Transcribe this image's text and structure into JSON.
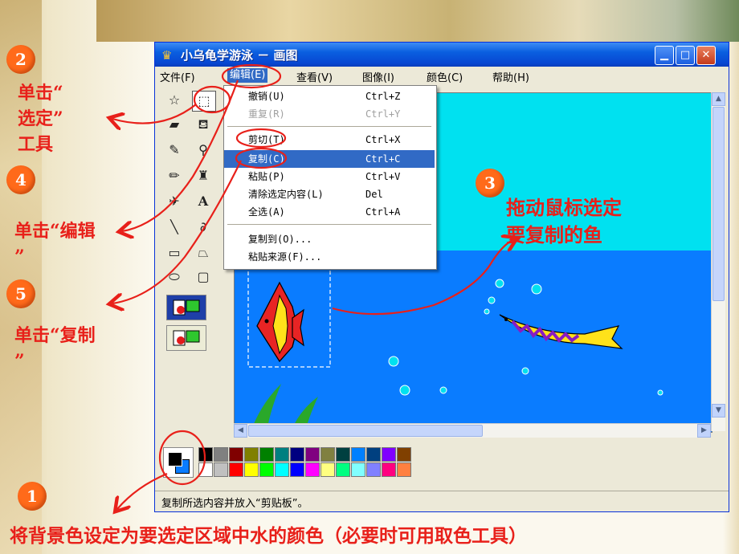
{
  "window": {
    "title": "小乌龟学游泳 － 画图",
    "controls": [
      "minimize",
      "maximize",
      "close"
    ]
  },
  "menubar": {
    "items": [
      "文件(F)",
      "编辑(E)",
      "查看(V)",
      "图像(I)",
      "颜色(C)",
      "帮助(H)"
    ],
    "active": "编辑(E)"
  },
  "edit_menu": {
    "items": [
      {
        "label": "撤销(U)",
        "shortcut": "Ctrl+Z",
        "enabled": true
      },
      {
        "label": "重复(R)",
        "shortcut": "Ctrl+Y",
        "enabled": false
      },
      {
        "label": "剪切(T)",
        "shortcut": "Ctrl+X",
        "enabled": true
      },
      {
        "label": "复制(C)",
        "shortcut": "Ctrl+C",
        "enabled": true,
        "highlighted": true
      },
      {
        "label": "粘贴(P)",
        "shortcut": "Ctrl+V",
        "enabled": true
      },
      {
        "label": "清除选定内容(L)",
        "shortcut": "Del",
        "enabled": true
      },
      {
        "label": "全选(A)",
        "shortcut": "Ctrl+A",
        "enabled": true
      },
      {
        "label": "复制到(O)...",
        "shortcut": "",
        "enabled": true
      },
      {
        "label": "粘贴来源(F)...",
        "shortcut": "",
        "enabled": true
      }
    ]
  },
  "tools": [
    "free-form-select",
    "select",
    "eraser",
    "fill",
    "pick-color",
    "magnifier",
    "pencil",
    "brush",
    "airbrush",
    "text",
    "line",
    "curve",
    "rectangle",
    "polygon",
    "ellipse",
    "rounded-rectangle"
  ],
  "tool_labels": {
    "text": "A"
  },
  "statusbar": {
    "text": "复制所选内容并放入“剪贴板”。"
  },
  "palette": {
    "top": [
      "#000000",
      "#808080",
      "#800000",
      "#808000",
      "#008000",
      "#008080",
      "#000080",
      "#800080",
      "#808040",
      "#004040",
      "#0080ff",
      "#004080",
      "#8000ff",
      "#804000"
    ],
    "bottom": [
      "#ffffff",
      "#c0c0c0",
      "#ff0000",
      "#ffff00",
      "#00ff00",
      "#00ffff",
      "#0000ff",
      "#ff00ff",
      "#ffff80",
      "#00ff80",
      "#80ffff",
      "#8080ff",
      "#ff0080",
      "#ff8040"
    ]
  },
  "annotations": {
    "step1": "1",
    "step2": "2",
    "step3": "3",
    "step4": "4",
    "step5": "5",
    "text2": [
      "单击“",
      "选定”",
      "工具"
    ],
    "text3": [
      "拖动鼠标选定",
      "要复制的鱼"
    ],
    "text4": [
      "单击“编辑",
      "”"
    ],
    "text5": [
      "单击“复制",
      "”"
    ],
    "bottom": "将背景色设定为要选定区域中水的颜色（必要时可用取色工具）"
  },
  "colors": {
    "annotation_red": "#e8201a",
    "step_orange": "#ff6a1a",
    "sky": "#00e1f0",
    "water": "#0a7cff",
    "highlight": "#316ac5"
  }
}
